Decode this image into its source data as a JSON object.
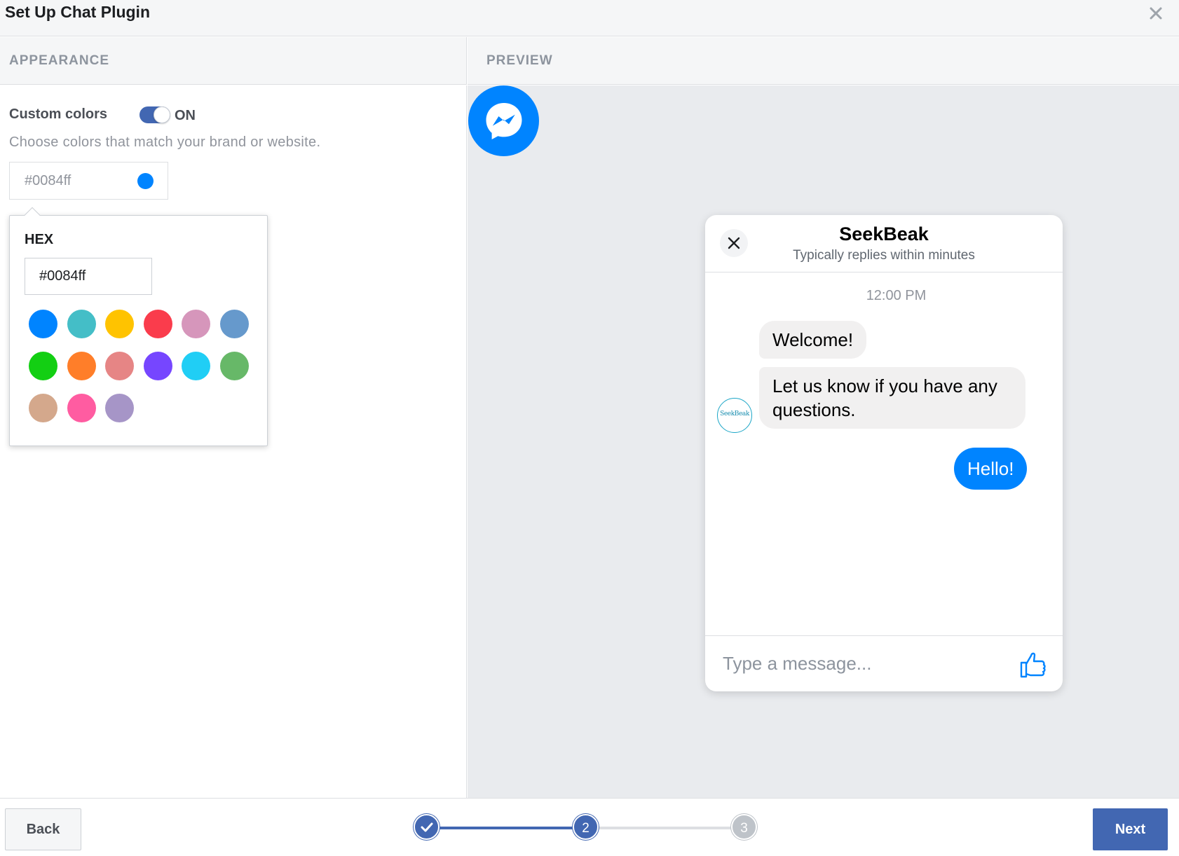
{
  "dialog": {
    "title": "Set Up Chat Plugin",
    "close_icon": "close-icon"
  },
  "sections": {
    "appearance": "APPEARANCE",
    "preview": "PREVIEW"
  },
  "appearance": {
    "custom_colors_label": "Custom colors",
    "toggle_state": "ON",
    "toggle_on": true,
    "description": "Choose colors that match your brand or website.",
    "color_value": "#0084ff",
    "accent_color": "#0084ff"
  },
  "picker": {
    "hex_label": "HEX",
    "hex_value": "#0084ff",
    "swatches": [
      "#0084ff",
      "#44bec7",
      "#ffc300",
      "#fa3c4c",
      "#d696bb",
      "#6699cc",
      "#13cf13",
      "#ff7e29",
      "#e68585",
      "#7646ff",
      "#20cef5",
      "#67b868",
      "#d4a88c",
      "#ff5ca1",
      "#a695c7"
    ]
  },
  "chat": {
    "launcher_icon": "messenger-icon",
    "page_name": "SeekBeak",
    "status": "Typically replies within minutes",
    "timestamp": "12:00 PM",
    "avatar_text": "SeekBeak",
    "messages_in": [
      "Welcome!",
      "Let us know if you have any questions."
    ],
    "message_out": "Hello!",
    "composer_placeholder": "Type a message...",
    "like_icon": "thumbs-up-icon"
  },
  "footer": {
    "back_label": "Back",
    "next_label": "Next",
    "steps": [
      "1",
      "2",
      "3"
    ],
    "current_step": 2
  }
}
